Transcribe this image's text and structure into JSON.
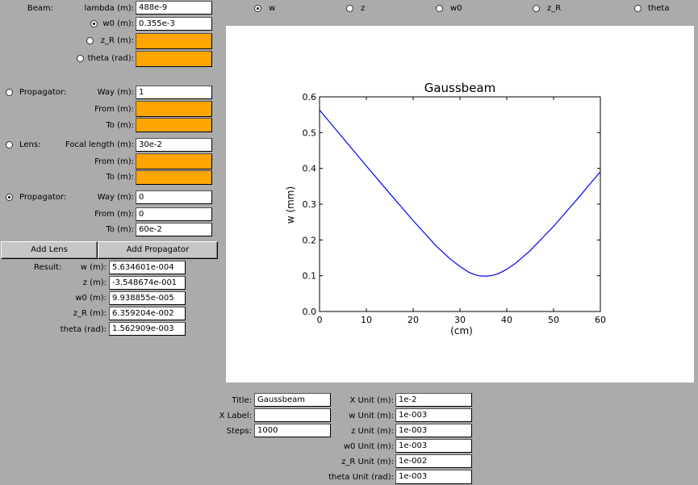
{
  "beam": {
    "section_label": "Beam:",
    "lambda_label": "lambda (m):",
    "lambda_value": "488e-9",
    "w0_label": "w0 (m):",
    "w0_value": "0.355e-3",
    "zr_label": "z_R (m):",
    "zr_value": "",
    "theta_label": "theta (rad):",
    "theta_value": ""
  },
  "propagator1": {
    "label": "Propagator:",
    "way_label": "Way (m):",
    "way_value": "1",
    "from_label": "From (m):",
    "from_value": "",
    "to_label": "To (m):",
    "to_value": ""
  },
  "lens": {
    "label": "Lens:",
    "focal_label": "Focal length (m):",
    "focal_value": "30e-2",
    "from_label": "From (m):",
    "from_value": "",
    "to_label": "To (m):",
    "to_value": ""
  },
  "propagator2": {
    "label": "Propagator:",
    "way_label": "Way (m):",
    "way_value": "0",
    "from_label": "From (m):",
    "from_value": "0",
    "to_label": "To (m):",
    "to_value": "60e-2"
  },
  "buttons": {
    "add_lens": "Add Lens",
    "add_propagator": "Add Propagator"
  },
  "result": {
    "label": "Result:",
    "w_label": "w (m):",
    "w_value": "5.634601e-004",
    "z_label": "z (m):",
    "z_value": "-3.548674e-001",
    "w0_label": "w0 (m):",
    "w0_value": "9.938855e-005",
    "zr_label": "z_R (m):",
    "zr_value": "6.359204e-002",
    "theta_label": "theta (rad):",
    "theta_value": "1.562909e-003"
  },
  "plot_select": {
    "w": "w",
    "z": "z",
    "w0": "w0",
    "zr": "z_R",
    "theta": "theta",
    "selected": "w"
  },
  "settings": {
    "title_label": "Title:",
    "title_value": "Gaussbeam",
    "xlabel_label": "X Label:",
    "xlabel_value": "",
    "steps_label": "Steps:",
    "steps_value": "1000",
    "xunit_label": "X Unit (m):",
    "xunit_value": "1e-2",
    "wunit_label": "w Unit (m):",
    "wunit_value": "1e-003",
    "zunit_label": "z Unit (m):",
    "zunit_value": "1e-003",
    "w0unit_label": "w0 Unit (m):",
    "w0unit_value": "1e-003",
    "zrunit_label": "z_R Unit (m):",
    "zrunit_value": "1e-002",
    "thetaunit_label": "theta Unit (rad):",
    "thetaunit_value": "1e-003"
  },
  "colors": {
    "empty_field": "#ffa500",
    "line": "#0000ff",
    "background": "#ababab"
  },
  "chart_data": {
    "type": "line",
    "title": "Gaussbeam",
    "xlabel": "(cm)",
    "ylabel": "w (mm)",
    "xlim": [
      0,
      60
    ],
    "ylim": [
      0.0,
      0.6
    ],
    "xticks": [
      "0",
      "10",
      "20",
      "30",
      "40",
      "50",
      "60"
    ],
    "yticks": [
      "0.0",
      "0.1",
      "0.2",
      "0.3",
      "0.4",
      "0.5",
      "0.6"
    ],
    "grid": false,
    "series": [
      {
        "color": "#0000ff",
        "x": [
          0,
          5,
          10,
          15,
          20,
          25,
          28,
          30,
          32,
          33,
          34,
          35,
          35.5,
          36,
          37,
          38,
          39,
          40,
          42,
          45,
          50,
          55,
          60
        ],
        "y": [
          0.563,
          0.485,
          0.407,
          0.33,
          0.254,
          0.182,
          0.146,
          0.126,
          0.109,
          0.104,
          0.1,
          0.099,
          0.099,
          0.099,
          0.101,
          0.105,
          0.111,
          0.118,
          0.136,
          0.17,
          0.238,
          0.313,
          0.391
        ]
      }
    ]
  }
}
